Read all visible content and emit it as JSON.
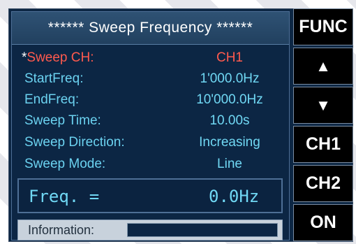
{
  "title": "****** Sweep Frequency ******",
  "rows": [
    {
      "star": "*",
      "label": "Sweep CH:",
      "value": "CH1"
    },
    {
      "label": "StartFreq:",
      "value": "1'000.0Hz"
    },
    {
      "label": "EndFreq:",
      "value": "10'000.0Hz"
    },
    {
      "label": "Sweep Time:",
      "value": "10.00s"
    },
    {
      "label": "Sweep Direction:",
      "value": "Increasing"
    },
    {
      "label": "Sweep Mode:",
      "value": "Line"
    }
  ],
  "freq": {
    "label": "Freq. =",
    "value": "0.0Hz"
  },
  "info": {
    "label": "Information:",
    "value": ""
  },
  "keys": [
    {
      "label": "FUNC"
    },
    {
      "label": "▲",
      "icon": "up-arrow-icon"
    },
    {
      "label": "▼",
      "icon": "down-arrow-icon"
    },
    {
      "label": "CH1"
    },
    {
      "label": "CH2"
    },
    {
      "label": "ON"
    }
  ],
  "colors": {
    "background": "#0d2744",
    "label": "#6bd2f0",
    "selected": "#ff5a4e",
    "title_bar": "#2f5274"
  }
}
